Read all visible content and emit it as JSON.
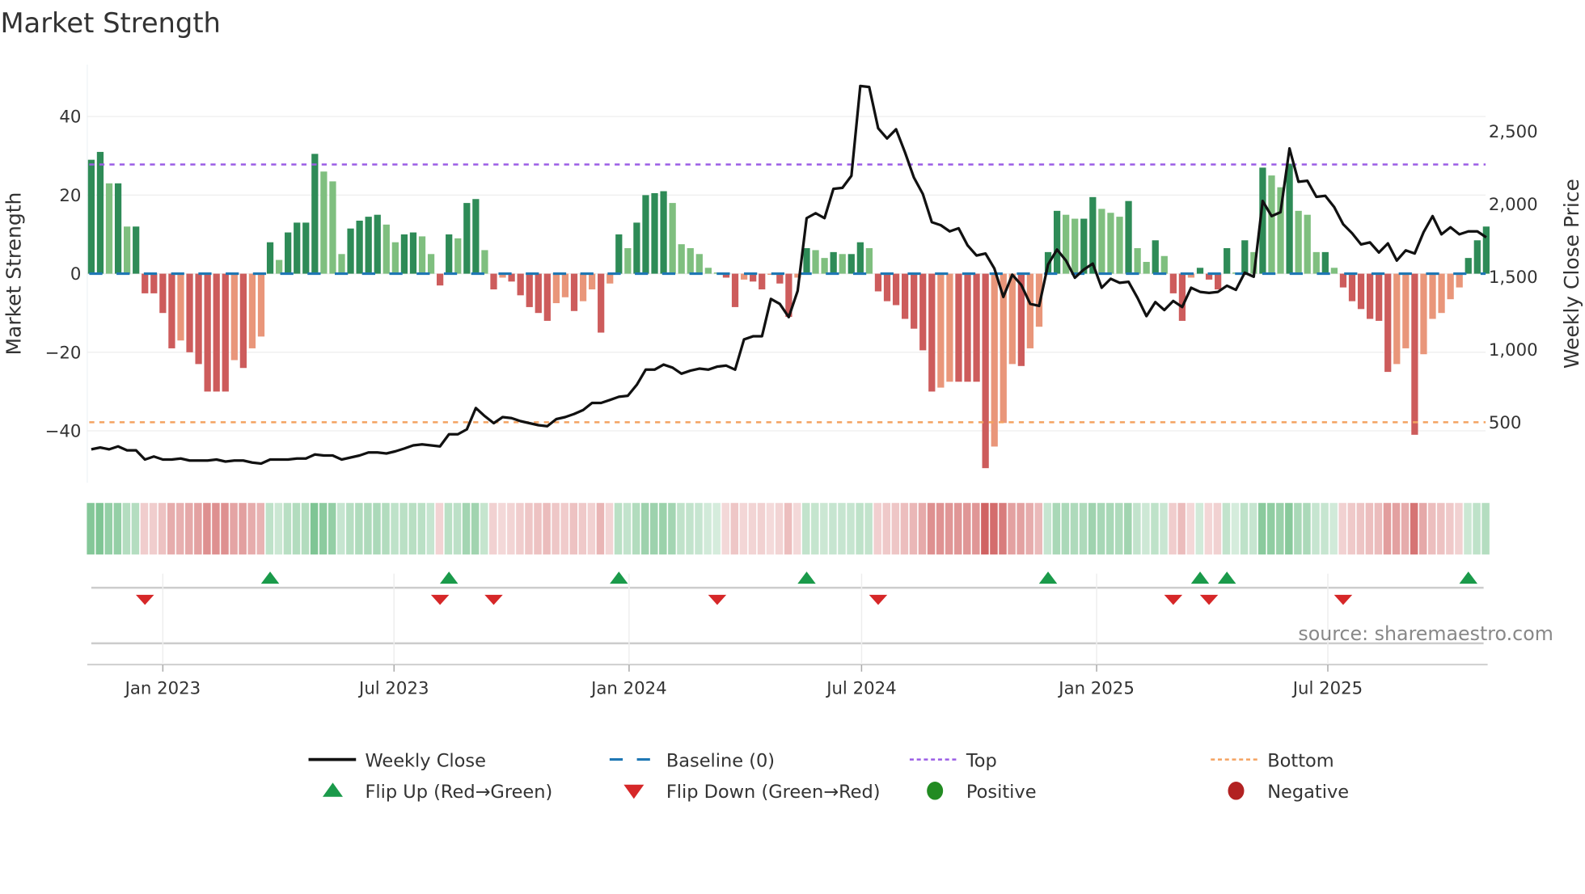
{
  "chart_data": {
    "type": "bar",
    "title": "Market Strength",
    "ylabel": "Market Strength",
    "y2label": "Weekly Close Price",
    "ylim": [
      -56,
      56
    ],
    "y2lim": [
      100,
      2880
    ],
    "start_week": "2022-11-06",
    "frequency": "weekly",
    "yticks": [
      "40",
      "20",
      "0",
      "−20",
      "−40"
    ],
    "ytick_values": [
      40,
      20,
      0,
      -20,
      -40
    ],
    "y2ticks": [
      "2,500",
      "2,000",
      "1,500",
      "1,000",
      "500"
    ],
    "y2tick_values": [
      2500,
      2000,
      1500,
      1000,
      500
    ],
    "xticks": [
      {
        "label": "Jan 2023",
        "date": "2023-01-01"
      },
      {
        "label": "Jul 2023",
        "date": "2023-07-01"
      },
      {
        "label": "Jan 2024",
        "date": "2024-01-01"
      },
      {
        "label": "Jul 2024",
        "date": "2024-07-01"
      },
      {
        "label": "Jan 2025",
        "date": "2025-01-01"
      },
      {
        "label": "Jul 2025",
        "date": "2025-07-01"
      }
    ],
    "top_level": 27.8,
    "bottom_level": -37.8,
    "baseline": 0,
    "strength": [
      29,
      31,
      23,
      23,
      12,
      12,
      -5,
      -5,
      -10,
      -19,
      -17,
      -20,
      -23,
      -30,
      -30,
      -30,
      -22,
      -24,
      -19,
      -16,
      8,
      3.5,
      10.5,
      13,
      13,
      30.5,
      26,
      23.5,
      5,
      11.5,
      13.5,
      14.5,
      15,
      12.5,
      8,
      10,
      10.5,
      9.5,
      5,
      -3,
      10,
      9,
      18,
      19,
      6,
      -4,
      -1,
      -2,
      -5.5,
      -8.5,
      -10,
      -12,
      -7.5,
      -6,
      -9.5,
      -7,
      -4,
      -15,
      -2.5,
      10,
      6.5,
      13,
      20,
      20.5,
      21,
      18,
      7.5,
      6.5,
      5,
      1.5,
      0.3,
      -1,
      -8.5,
      -1.5,
      -2,
      -4,
      -0.3,
      -2.5,
      -11,
      -1,
      6.5,
      6,
      4,
      5.5,
      5,
      5,
      8,
      6.5,
      -4.5,
      -7,
      -8,
      -11.5,
      -14,
      -19.5,
      -30,
      -29,
      -27.5,
      -27.5,
      -27.5,
      -27.5,
      -49.5,
      -44,
      -38,
      -23,
      -23.5,
      -19,
      -13.5,
      5.5,
      16,
      15,
      14,
      14,
      19.5,
      16.5,
      15.5,
      14.5,
      18.5,
      6.5,
      3,
      8.5,
      4.5,
      -5,
      -12,
      -1,
      1.5,
      -1.5,
      -4,
      6.5,
      0.3,
      8.5,
      5.5,
      27,
      25,
      22,
      28,
      16,
      15,
      5.5,
      5.5,
      1.5,
      -3.5,
      -7,
      -9,
      -11.5,
      -12,
      -25,
      -23,
      -19,
      -41,
      -20.5,
      -11.5,
      -10,
      -6.5,
      -3.5,
      4,
      8.5,
      12
    ],
    "weekly_close": [
      313,
      326,
      313,
      333,
      306,
      306,
      243,
      264,
      243,
      243,
      250,
      236,
      236,
      236,
      243,
      229,
      236,
      236,
      222,
      215,
      243,
      243,
      243,
      250,
      250,
      278,
      271,
      271,
      243,
      257,
      271,
      292,
      292,
      285,
      299,
      319,
      340,
      347,
      340,
      333,
      417,
      417,
      451,
      597,
      542,
      493,
      535,
      528,
      507,
      493,
      479,
      472,
      521,
      535,
      556,
      583,
      632,
      632,
      653,
      674,
      681,
      757,
      861,
      861,
      896,
      875,
      833,
      854,
      868,
      861,
      882,
      889,
      861,
      1069,
      1090,
      1090,
      1347,
      1313,
      1222,
      1403,
      1903,
      1937,
      1903,
      2104,
      2111,
      2194,
      2812,
      2805,
      2521,
      2451,
      2514,
      2354,
      2181,
      2069,
      1875,
      1854,
      1812,
      1833,
      1715,
      1646,
      1660,
      1556,
      1361,
      1514,
      1444,
      1313,
      1299,
      1583,
      1687,
      1611,
      1493,
      1549,
      1590,
      1424,
      1486,
      1458,
      1465,
      1354,
      1229,
      1326,
      1271,
      1333,
      1292,
      1424,
      1396,
      1389,
      1396,
      1438,
      1410,
      1528,
      1500,
      2021,
      1917,
      1944,
      2382,
      2153,
      2160,
      2049,
      2056,
      1979,
      1861,
      1799,
      1722,
      1736,
      1667,
      1729,
      1611,
      1681,
      1660,
      1806,
      1917,
      1792,
      1840,
      1792,
      1812,
      1812,
      1771
    ],
    "flip_up_weeks": [
      20,
      40,
      59,
      80,
      107,
      124,
      127,
      154
    ],
    "flip_down_weeks": [
      6,
      39,
      45,
      70,
      88,
      121,
      125,
      140
    ],
    "legend": {
      "placement": "bottom",
      "items": [
        {
          "key": "close",
          "label": "Weekly Close"
        },
        {
          "key": "baseline",
          "label": "Baseline (0)"
        },
        {
          "key": "top",
          "label": "Top"
        },
        {
          "key": "bottom",
          "label": "Bottom"
        },
        {
          "key": "flip_up",
          "label": "Flip Up (Red→Green)"
        },
        {
          "key": "flip_down",
          "label": "Flip Down (Green→Red)"
        },
        {
          "key": "positive",
          "label": "Positive"
        },
        {
          "key": "negative",
          "label": "Negative"
        }
      ]
    },
    "source": "source: sharemaestro.com"
  },
  "colors": {
    "strong_green": "#2e8b57",
    "weak_green": "#7fbf7f",
    "strong_red": "#cd5c5c",
    "weak_red": "#e9967a",
    "close": "#111111",
    "baseline": "#1f77b4",
    "top": "#9b5de5",
    "bottom": "#f4a261",
    "flip_up": "#1a9a4a",
    "flip_down": "#d62728",
    "positive": "#228b22",
    "negative": "#b22222"
  }
}
